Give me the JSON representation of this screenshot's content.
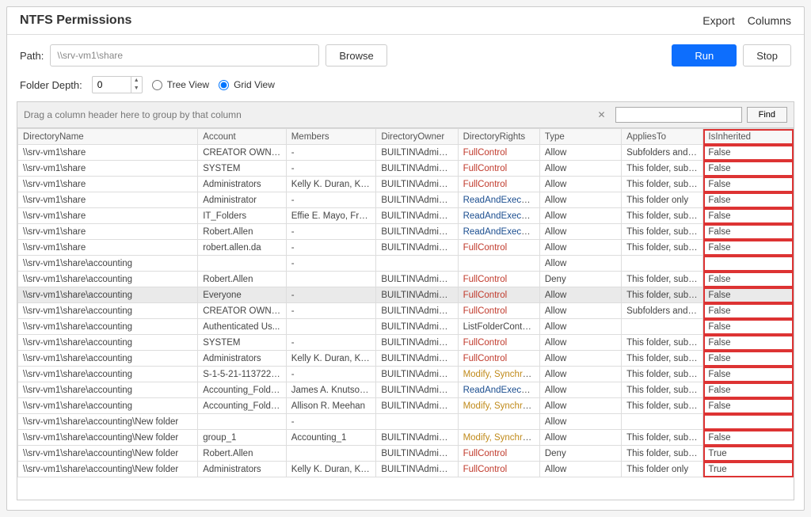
{
  "header": {
    "title": "NTFS Permissions",
    "export": "Export",
    "columns": "Columns"
  },
  "toolbar": {
    "path_label": "Path:",
    "path_value": "\\\\srv-vm1\\share",
    "browse": "Browse",
    "run": "Run",
    "stop": "Stop"
  },
  "options": {
    "depth_label": "Folder Depth:",
    "depth_value": "0",
    "tree_view": "Tree View",
    "grid_view": "Grid View"
  },
  "grid": {
    "group_hint": "Drag a column header here to group by that column",
    "find_label": "Find",
    "columns": [
      "DirectoryName",
      "Account",
      "Members",
      "DirectoryOwner",
      "DirectoryRights",
      "Type",
      "AppliesTo",
      "IsInherited"
    ],
    "rows": [
      {
        "dir": "\\\\srv-vm1\\share",
        "acct": "CREATOR OWNER",
        "members": "-",
        "owner": "BUILTIN\\Administr...",
        "rights": "FullControl",
        "rclass": "full",
        "type": "Allow",
        "applies": "Subfolders and files",
        "inh": "False"
      },
      {
        "dir": "\\\\srv-vm1\\share",
        "acct": "SYSTEM",
        "members": "-",
        "owner": "BUILTIN\\Administr...",
        "rights": "FullControl",
        "rclass": "full",
        "type": "Allow",
        "applies": "This folder, subfol...",
        "inh": "False"
      },
      {
        "dir": "\\\\srv-vm1\\share",
        "acct": "Administrators",
        "members": "Kelly K. Duran, Kel...",
        "owner": "BUILTIN\\Administr...",
        "rights": "FullControl",
        "rclass": "full",
        "type": "Allow",
        "applies": "This folder, subfol...",
        "inh": "False"
      },
      {
        "dir": "\\\\srv-vm1\\share",
        "acct": "Administrator",
        "members": "-",
        "owner": "BUILTIN\\Administr...",
        "rights": "ReadAndExecute,...",
        "rclass": "read",
        "type": "Allow",
        "applies": "This folder only",
        "inh": "False"
      },
      {
        "dir": "\\\\srv-vm1\\share",
        "acct": "IT_Folders",
        "members": "Effie E. Mayo, Fre...",
        "owner": "BUILTIN\\Administr...",
        "rights": "ReadAndExecute,...",
        "rclass": "read",
        "type": "Allow",
        "applies": "This folder, subfol...",
        "inh": "False"
      },
      {
        "dir": "\\\\srv-vm1\\share",
        "acct": "Robert.Allen",
        "members": "-",
        "owner": "BUILTIN\\Administr...",
        "rights": "ReadAndExecute,...",
        "rclass": "read",
        "type": "Allow",
        "applies": "This folder, subfol...",
        "inh": "False"
      },
      {
        "dir": "\\\\srv-vm1\\share",
        "acct": "robert.allen.da",
        "members": "-",
        "owner": "BUILTIN\\Administr...",
        "rights": "FullControl",
        "rclass": "full",
        "type": "Allow",
        "applies": "This folder, subfol...",
        "inh": "False"
      },
      {
        "dir": "\\\\srv-vm1\\share\\accounting",
        "acct": "",
        "members": "-",
        "owner": "",
        "rights": "",
        "rclass": "",
        "type": "Allow",
        "applies": "",
        "inh": ""
      },
      {
        "dir": "\\\\srv-vm1\\share\\accounting",
        "acct": "Robert.Allen",
        "members": "",
        "owner": "BUILTIN\\Administr...",
        "rights": "FullControl",
        "rclass": "full",
        "type": "Deny",
        "applies": "This folder, subfol...",
        "inh": "False"
      },
      {
        "dir": "\\\\srv-vm1\\share\\accounting",
        "acct": "Everyone",
        "members": "-",
        "owner": "BUILTIN\\Administr...",
        "rights": "FullControl",
        "rclass": "full",
        "type": "Allow",
        "applies": "This folder, subfol...",
        "inh": "False",
        "selected": true
      },
      {
        "dir": "\\\\srv-vm1\\share\\accounting",
        "acct": "CREATOR OWNER",
        "members": "-",
        "owner": "BUILTIN\\Administr...",
        "rights": "FullControl",
        "rclass": "full",
        "type": "Allow",
        "applies": "Subfolders and files",
        "inh": "False"
      },
      {
        "dir": "\\\\srv-vm1\\share\\accounting",
        "acct": "Authenticated Us...",
        "members": "",
        "owner": "BUILTIN\\Administr...",
        "rights": "ListFolderContent...",
        "rclass": "list",
        "type": "Allow",
        "applies": "",
        "inh": "False"
      },
      {
        "dir": "\\\\srv-vm1\\share\\accounting",
        "acct": "SYSTEM",
        "members": "-",
        "owner": "BUILTIN\\Administr...",
        "rights": "FullControl",
        "rclass": "full",
        "type": "Allow",
        "applies": "This folder, subfol...",
        "inh": "False"
      },
      {
        "dir": "\\\\srv-vm1\\share\\accounting",
        "acct": "Administrators",
        "members": "Kelly K. Duran, Kel...",
        "owner": "BUILTIN\\Administr...",
        "rights": "FullControl",
        "rclass": "full",
        "type": "Allow",
        "applies": "This folder, subfol...",
        "inh": "False"
      },
      {
        "dir": "\\\\srv-vm1\\share\\accounting",
        "acct": "S-1-5-21-1137229...",
        "members": "-",
        "owner": "BUILTIN\\Administr...",
        "rights": "Modify, Synchronize",
        "rclass": "modify",
        "type": "Allow",
        "applies": "This folder, subfol...",
        "inh": "False"
      },
      {
        "dir": "\\\\srv-vm1\\share\\accounting",
        "acct": "Accounting_Folde...",
        "members": "James A. Knutson...",
        "owner": "BUILTIN\\Administr...",
        "rights": "ReadAndExecute,...",
        "rclass": "read",
        "type": "Allow",
        "applies": "This folder, subfol...",
        "inh": "False"
      },
      {
        "dir": "\\\\srv-vm1\\share\\accounting",
        "acct": "Accounting_Folde...",
        "members": "Allison R. Meehan",
        "owner": "BUILTIN\\Administr...",
        "rights": "Modify, Synchronize",
        "rclass": "modify",
        "type": "Allow",
        "applies": "This folder, subfol...",
        "inh": "False"
      },
      {
        "dir": "\\\\srv-vm1\\share\\accounting\\New folder",
        "acct": "",
        "members": "-",
        "owner": "",
        "rights": "",
        "rclass": "",
        "type": "Allow",
        "applies": "",
        "inh": ""
      },
      {
        "dir": "\\\\srv-vm1\\share\\accounting\\New folder",
        "acct": "group_1",
        "members": "Accounting_1",
        "owner": "BUILTIN\\Administr...",
        "rights": "Modify, Synchronize",
        "rclass": "modify",
        "type": "Allow",
        "applies": "This folder, subfol...",
        "inh": "False"
      },
      {
        "dir": "\\\\srv-vm1\\share\\accounting\\New folder",
        "acct": "Robert.Allen",
        "members": "",
        "owner": "BUILTIN\\Administr...",
        "rights": "FullControl",
        "rclass": "full",
        "type": "Deny",
        "applies": "This folder, subfol...",
        "inh": "True"
      },
      {
        "dir": "\\\\srv-vm1\\share\\accounting\\New folder",
        "acct": "Administrators",
        "members": "Kelly K. Duran, Kel...",
        "owner": "BUILTIN\\Administr...",
        "rights": "FullControl",
        "rclass": "full",
        "type": "Allow",
        "applies": "This folder only",
        "inh": "True"
      }
    ]
  }
}
